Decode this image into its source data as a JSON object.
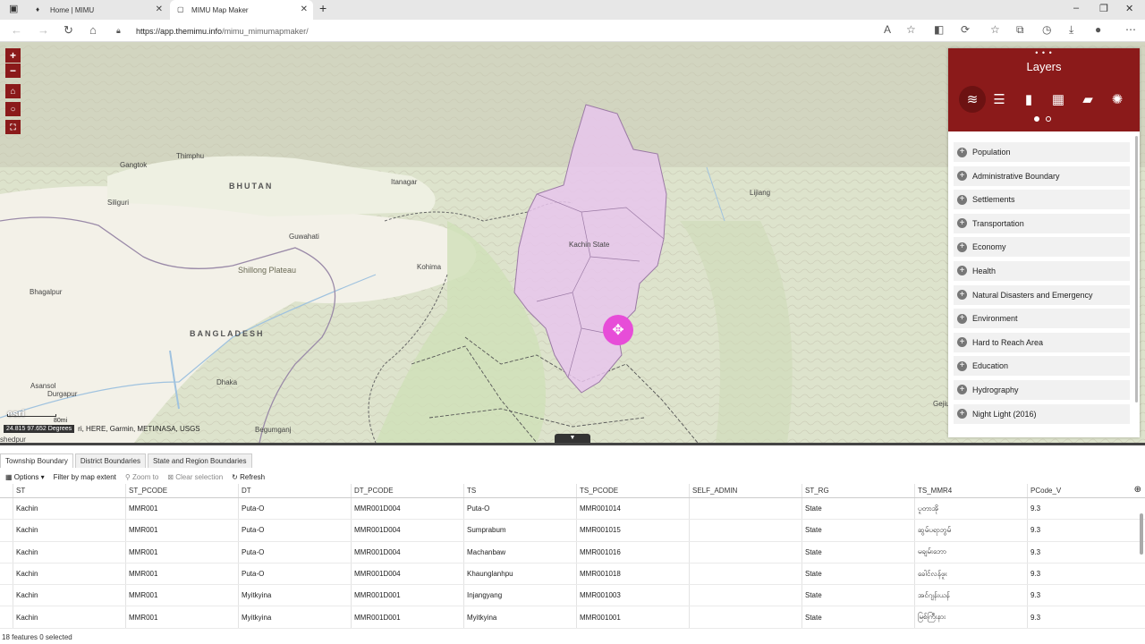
{
  "browser": {
    "tabs": [
      {
        "title": "Home | MIMU"
      },
      {
        "title": "MIMU Map Maker"
      }
    ],
    "new_tab": "+",
    "url_host": "https://app.themimu.info",
    "url_path": "/mimu_mimumapmaker/"
  },
  "map": {
    "labels": {
      "thimphu": "Thimphu",
      "gangtok": "Gangtok",
      "bhutan": "BHUTAN",
      "itanagar": "Itanagar",
      "siliguri": "Siliguri",
      "guwahati": "Guwahati",
      "shillong": "Shillong Plateau",
      "kohima": "Kohima",
      "bhagalpur": "Bhagalpur",
      "bangladesh": "BANGLADESH",
      "kachin": "Kachin State",
      "lijiang": "Lijiang",
      "asansol": "Asansol",
      "durgapur": "Durgapur",
      "dhaka": "Dhaka",
      "begumganj": "Begumganj",
      "gejiu": "Gejiu",
      "shedpur": "shedpur"
    },
    "coords": "24.815 97.652 Degrees",
    "attribution": "ri, HERE, Garmin, METI/NASA, USGS",
    "scale": "80mi",
    "esri": "esri"
  },
  "layers_panel": {
    "title": "Layers",
    "icons": [
      "layers-icon",
      "list-icon",
      "bookmark-icon",
      "grid-icon",
      "education-icon",
      "palette-icon"
    ],
    "items": [
      "Population",
      "Administrative Boundary",
      "Settlements",
      "Transportation",
      "Economy",
      "Health",
      "Natural Disasters and Emergency",
      "Environment",
      "Hard to Reach Area",
      "Education",
      "Hydrography",
      "Night Light (2016)"
    ]
  },
  "table": {
    "tabs": [
      "Township Boundary",
      "District Boundaries",
      "State and Region Boundaries"
    ],
    "actions": {
      "options": "Options",
      "filter": "Filter by map extent",
      "zoom": "Zoom to",
      "clear": "Clear selection",
      "refresh": "Refresh"
    },
    "columns": [
      "ST",
      "ST_PCODE",
      "DT",
      "DT_PCODE",
      "TS",
      "TS_PCODE",
      "SELF_ADMIN",
      "ST_RG",
      "TS_MMR4",
      "PCode_V"
    ],
    "rows": [
      [
        "Kachin",
        "MMR001",
        "Puta-O",
        "MMR001D004",
        "Puta-O",
        "MMR001014",
        "",
        "State",
        "ပူတာအို",
        "9.3"
      ],
      [
        "Kachin",
        "MMR001",
        "Puta-O",
        "MMR001D004",
        "Sumprabum",
        "MMR001015",
        "",
        "State",
        "ဆွမ်ပရာဘွမ်",
        "9.3"
      ],
      [
        "Kachin",
        "MMR001",
        "Puta-O",
        "MMR001D004",
        "Machanbaw",
        "MMR001016",
        "",
        "State",
        "မချမ်းဘော",
        "9.3"
      ],
      [
        "Kachin",
        "MMR001",
        "Puta-O",
        "MMR001D004",
        "Khaunglanhpu",
        "MMR001018",
        "",
        "State",
        "ခေါင်လန်ဖူး",
        "9.3"
      ],
      [
        "Kachin",
        "MMR001",
        "Myitkyina",
        "MMR001D001",
        "Injangyang",
        "MMR001003",
        "",
        "State",
        "အင်ဂျန်းယန်",
        "9.3"
      ],
      [
        "Kachin",
        "MMR001",
        "Myitkyina",
        "MMR001D001",
        "Myitkyina",
        "MMR001001",
        "",
        "State",
        "မြစ်ကြီးနား",
        "9.3"
      ]
    ],
    "footer": "18 features 0 selected"
  },
  "colors": {
    "brand": "#8b1a1a",
    "highlight_polygon": "#e7c6ec",
    "cursor": "#e74dd8"
  }
}
